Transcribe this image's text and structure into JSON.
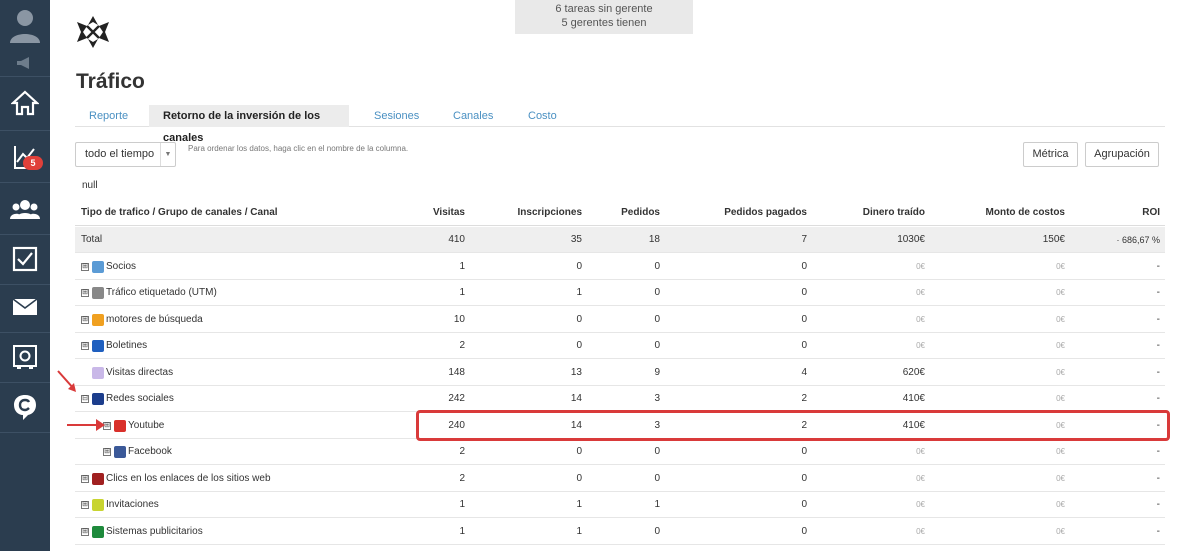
{
  "sidebar": {
    "items": [
      {
        "name": "profile-icon"
      },
      {
        "name": "megaphone-icon"
      },
      {
        "name": "home-icon"
      },
      {
        "name": "analytics-icon",
        "badge": "5"
      },
      {
        "name": "contacts-icon"
      },
      {
        "name": "tasks-icon"
      },
      {
        "name": "mail-icon"
      },
      {
        "name": "settings-icon"
      },
      {
        "name": "chat-icon"
      }
    ]
  },
  "notice": {
    "line1": "6 tareas sin gerente",
    "line2": "5 gerentes tienen"
  },
  "page": {
    "title": "Tráfico"
  },
  "tabs": [
    {
      "label": "Reporte"
    },
    {
      "label": "Retorno de la inversión de los canales",
      "active": true
    },
    {
      "label": "Sesiones"
    },
    {
      "label": "Canales"
    },
    {
      "label": "Costo"
    }
  ],
  "controls": {
    "period": "todo el tiempo",
    "hint": "Para ordenar los datos, haga clic en el nombre de la columna.",
    "metric_btn": "Métrica",
    "group_btn": "Agrupación"
  },
  "null_text": "null",
  "table": {
    "headers": {
      "name": "Tipo de trafico / Grupo de canales / Canal",
      "visits": "Visitas",
      "signups": "Inscripciones",
      "orders": "Pedidos",
      "paid": "Pedidos pagados",
      "money": "Dinero traído",
      "costs": "Monto de costos",
      "roi": "ROI"
    },
    "rows": [
      {
        "name": "Total",
        "visits": "410",
        "signups": "35",
        "orders": "18",
        "paid": "7",
        "money": "1030€",
        "costs": "150€",
        "roi": "· 686,67 %"
      },
      {
        "name": "Socios",
        "icon": "chat-bubble-icon",
        "color": "#5b9bd5",
        "expander": "⊞",
        "visits": "1",
        "signups": "0",
        "orders": "0",
        "paid": "0",
        "money": "0€",
        "costs": "0€",
        "roi": "-"
      },
      {
        "name": "Tráfico etiquetado (UTM)",
        "icon": "list-icon",
        "color": "#888888",
        "expander": "⊞",
        "visits": "1",
        "signups": "1",
        "orders": "0",
        "paid": "0",
        "money": "0€",
        "costs": "0€",
        "roi": "-"
      },
      {
        "name": "motores de búsqueda",
        "icon": "search-icon",
        "color": "#f0a020",
        "expander": "⊞",
        "visits": "10",
        "signups": "0",
        "orders": "0",
        "paid": "0",
        "money": "0€",
        "costs": "0€",
        "roi": "-"
      },
      {
        "name": "Boletines",
        "icon": "newsletter-icon",
        "color": "#1f5fbf",
        "expander": "⊞",
        "visits": "2",
        "signups": "0",
        "orders": "0",
        "paid": "0",
        "money": "0€",
        "costs": "0€",
        "roi": "-"
      },
      {
        "name": "Visitas directas",
        "icon": "arrow-up-icon",
        "color": "#c9b8e8",
        "expander": "",
        "visits": "148",
        "signups": "13",
        "orders": "9",
        "paid": "4",
        "money": "620€",
        "costs": "0€",
        "roi": "-"
      },
      {
        "name": "Redes sociales",
        "icon": "person-icon",
        "color": "#1c3d8c",
        "expander": "⊟",
        "visits": "242",
        "signups": "14",
        "orders": "3",
        "paid": "2",
        "money": "410€",
        "costs": "0€",
        "roi": "-"
      },
      {
        "name": "Youtube",
        "icon": "youtube-icon",
        "color": "#d9302a",
        "expander": "⊞",
        "indent": true,
        "visits": "240",
        "signups": "14",
        "orders": "3",
        "paid": "2",
        "money": "410€",
        "costs": "0€",
        "roi": "-"
      },
      {
        "name": "Facebook",
        "icon": "facebook-icon",
        "color": "#3b5998",
        "expander": "⊞",
        "indent": true,
        "visits": "2",
        "signups": "0",
        "orders": "0",
        "paid": "0",
        "money": "0€",
        "costs": "0€",
        "roi": "-"
      },
      {
        "name": "Clics en los enlaces de los sitios web",
        "icon": "link-icon",
        "color": "#a02020",
        "expander": "⊞",
        "visits": "2",
        "signups": "0",
        "orders": "0",
        "paid": "0",
        "money": "0€",
        "costs": "0€",
        "roi": "-"
      },
      {
        "name": "Invitaciones",
        "icon": "invite-icon",
        "color": "#c8d430",
        "expander": "⊞",
        "visits": "1",
        "signups": "1",
        "orders": "1",
        "paid": "0",
        "money": "0€",
        "costs": "0€",
        "roi": "-"
      },
      {
        "name": "Sistemas publicitarios",
        "icon": "ads-icon",
        "color": "#1e8a3c",
        "expander": "⊞",
        "visits": "1",
        "signups": "1",
        "orders": "0",
        "paid": "0",
        "money": "0€",
        "costs": "0€",
        "roi": "-"
      }
    ]
  },
  "colors": {
    "sidebar": "#2b3d4f",
    "accent": "#4a90c2",
    "highlight": "#d93a3a",
    "badge": "#e0403a"
  }
}
